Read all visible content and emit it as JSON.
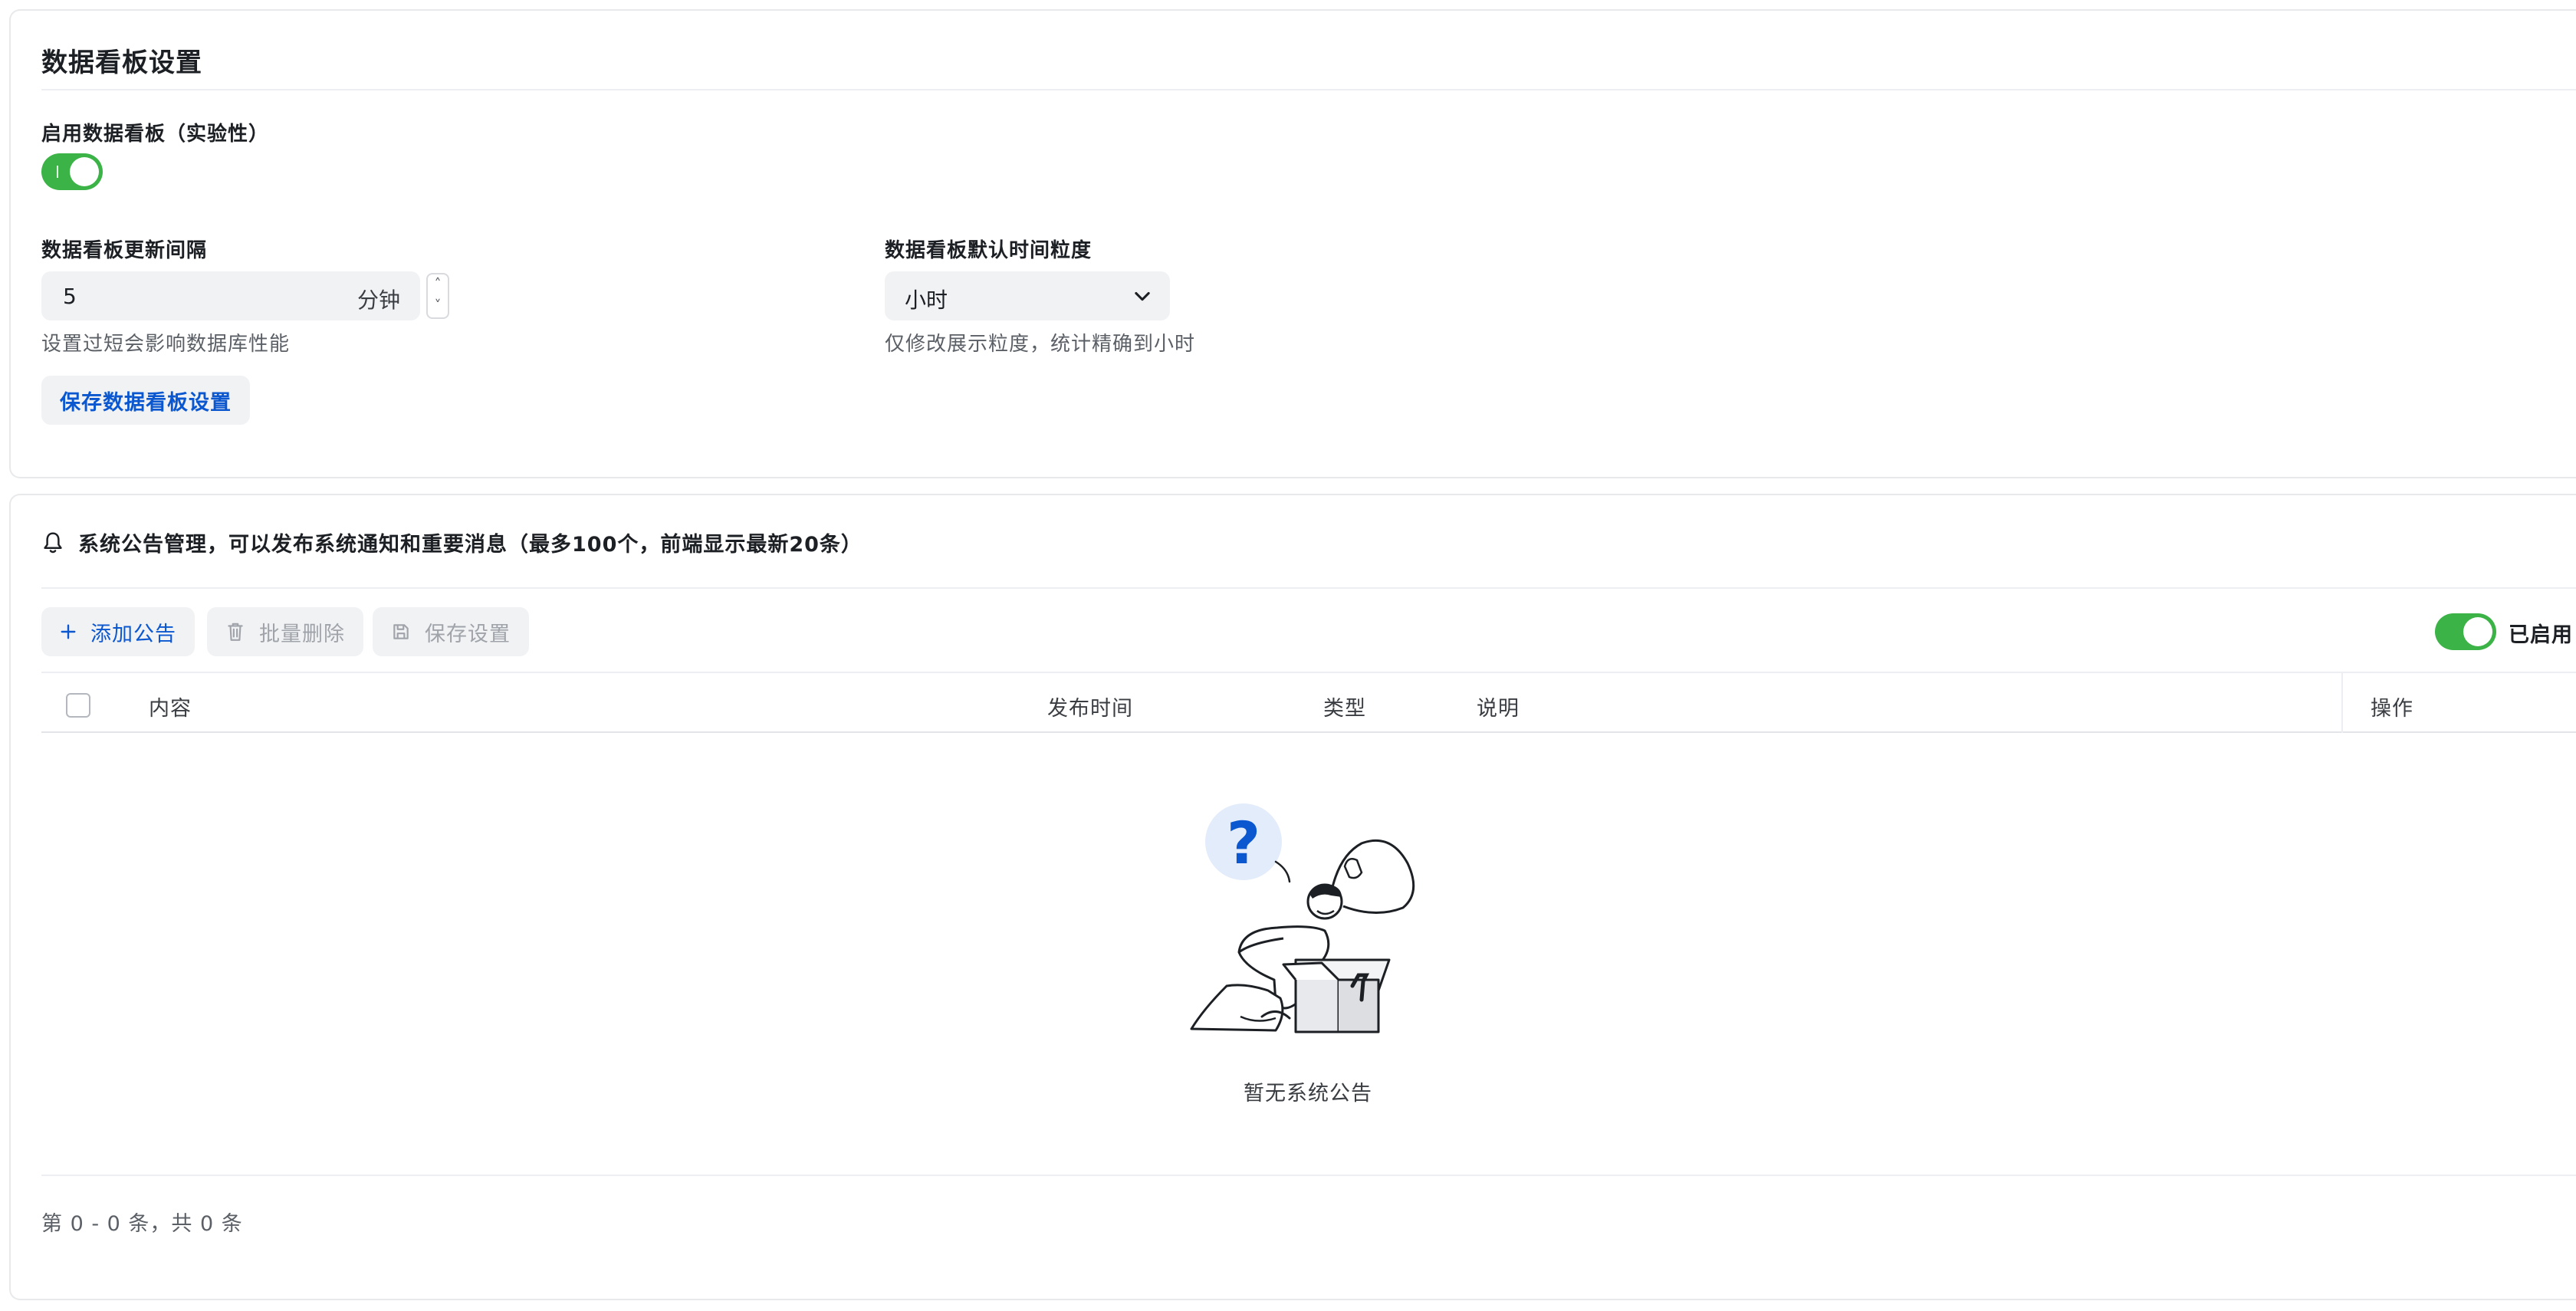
{
  "dashboard": {
    "title": "数据看板设置",
    "enable_label": "启用数据看板（实验性）",
    "interval_label": "数据看板更新间隔",
    "interval_value": "5",
    "interval_unit": "分钟",
    "interval_help": "设置过短会影响数据库性能",
    "granularity_label": "数据看板默认时间粒度",
    "granularity_value": "小时",
    "granularity_help": "仅修改展示粒度，统计精确到小时",
    "save_label": "保存数据看板设置"
  },
  "announcements": {
    "header": "系统公告管理，可以发布系统通知和重要消息（最多100个，前端显示最新20条）",
    "add_label": "添加公告",
    "batch_delete_label": "批量删除",
    "save_label": "保存设置",
    "enabled_label": "已启用",
    "columns": [
      "内容",
      "发布时间",
      "类型",
      "说明",
      "操作"
    ],
    "empty_text": "暂无系统公告",
    "pagination": "第 0 - 0 条，共 0 条"
  },
  "colors": {
    "accent": "#0b57d0",
    "switch_on": "#3bb346"
  },
  "icons": [
    "bell-icon",
    "plus-icon",
    "trash-icon",
    "save-icon",
    "chevron-down-icon",
    "question-icon"
  ]
}
